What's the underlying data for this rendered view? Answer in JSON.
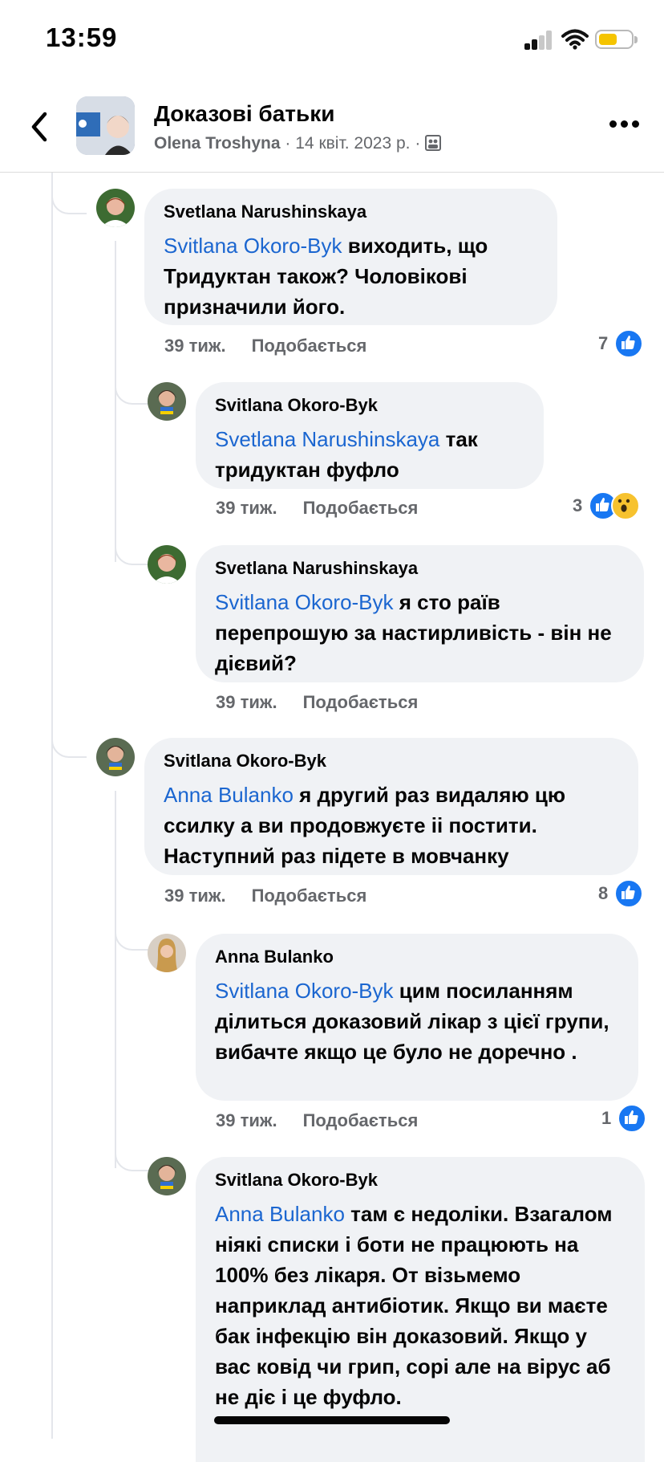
{
  "status_bar": {
    "time": "13:59"
  },
  "header": {
    "title": "Доказові батьки",
    "author": "Olena Troshyna",
    "separator": "·",
    "date": "14 квіт. 2023 р.",
    "privacy_icon": "group-icon"
  },
  "comments": [
    {
      "author": "Svetlana Narushinskaya",
      "mention": "Svitlana Okoro-Byk",
      "text": " виходить, що Тридуктан також? Чоловікові призначили його.",
      "time": "39 тиж.",
      "like_label": "Подобається",
      "reactions": "7"
    },
    {
      "author": "Svitlana Okoro-Byk",
      "mention": "Svetlana Narushinskaya",
      "text": " так тридуктан фуфло",
      "time": "39 тиж.",
      "like_label": "Подобається",
      "reactions": "3"
    },
    {
      "author": "Svetlana Narushinskaya",
      "mention": "Svitlana Okoro-Byk",
      "text": " я сто раїв перепрошую за настирливість - він не дієвий?",
      "time": "39 тиж.",
      "like_label": "Подобається",
      "reactions": ""
    },
    {
      "author": "Svitlana Okoro-Byk",
      "mention": "Anna  Bulanko",
      "text": " я другий раз видаляю цю ссилку а ви продовжуєте іі постити. Наступний раз підете в мовчанку",
      "time": "39 тиж.",
      "like_label": "Подобається",
      "reactions": "8"
    },
    {
      "author": "Anna  Bulanko",
      "mention": "Svitlana Okoro-Byk",
      "text": " цим посиланням ділиться доказовий лікар з цієї групи, вибачте якщо це було не доречно .",
      "time": "39 тиж.",
      "like_label": "Подобається",
      "reactions": "1"
    },
    {
      "author": "Svitlana Okoro-Byk",
      "mention": "Anna  Bulanko",
      "text": " там є недоліки. Взагалом ніякі списки і боти не працюють на 100% без лікаря. От візьмемо наприклад антибіотик. Якщо ви маєте бак інфекцію він доказовий. Якщо у вас ковід чи грип, сорі але на вірус аб не діє і це фуфло.",
      "time": "",
      "like_label": "",
      "reactions": ""
    }
  ],
  "colors": {
    "mention": "#1b66d0",
    "bubble": "#f0f2f5",
    "meta": "#65676b",
    "like": "#1877f2",
    "battery": "#f5c400"
  }
}
